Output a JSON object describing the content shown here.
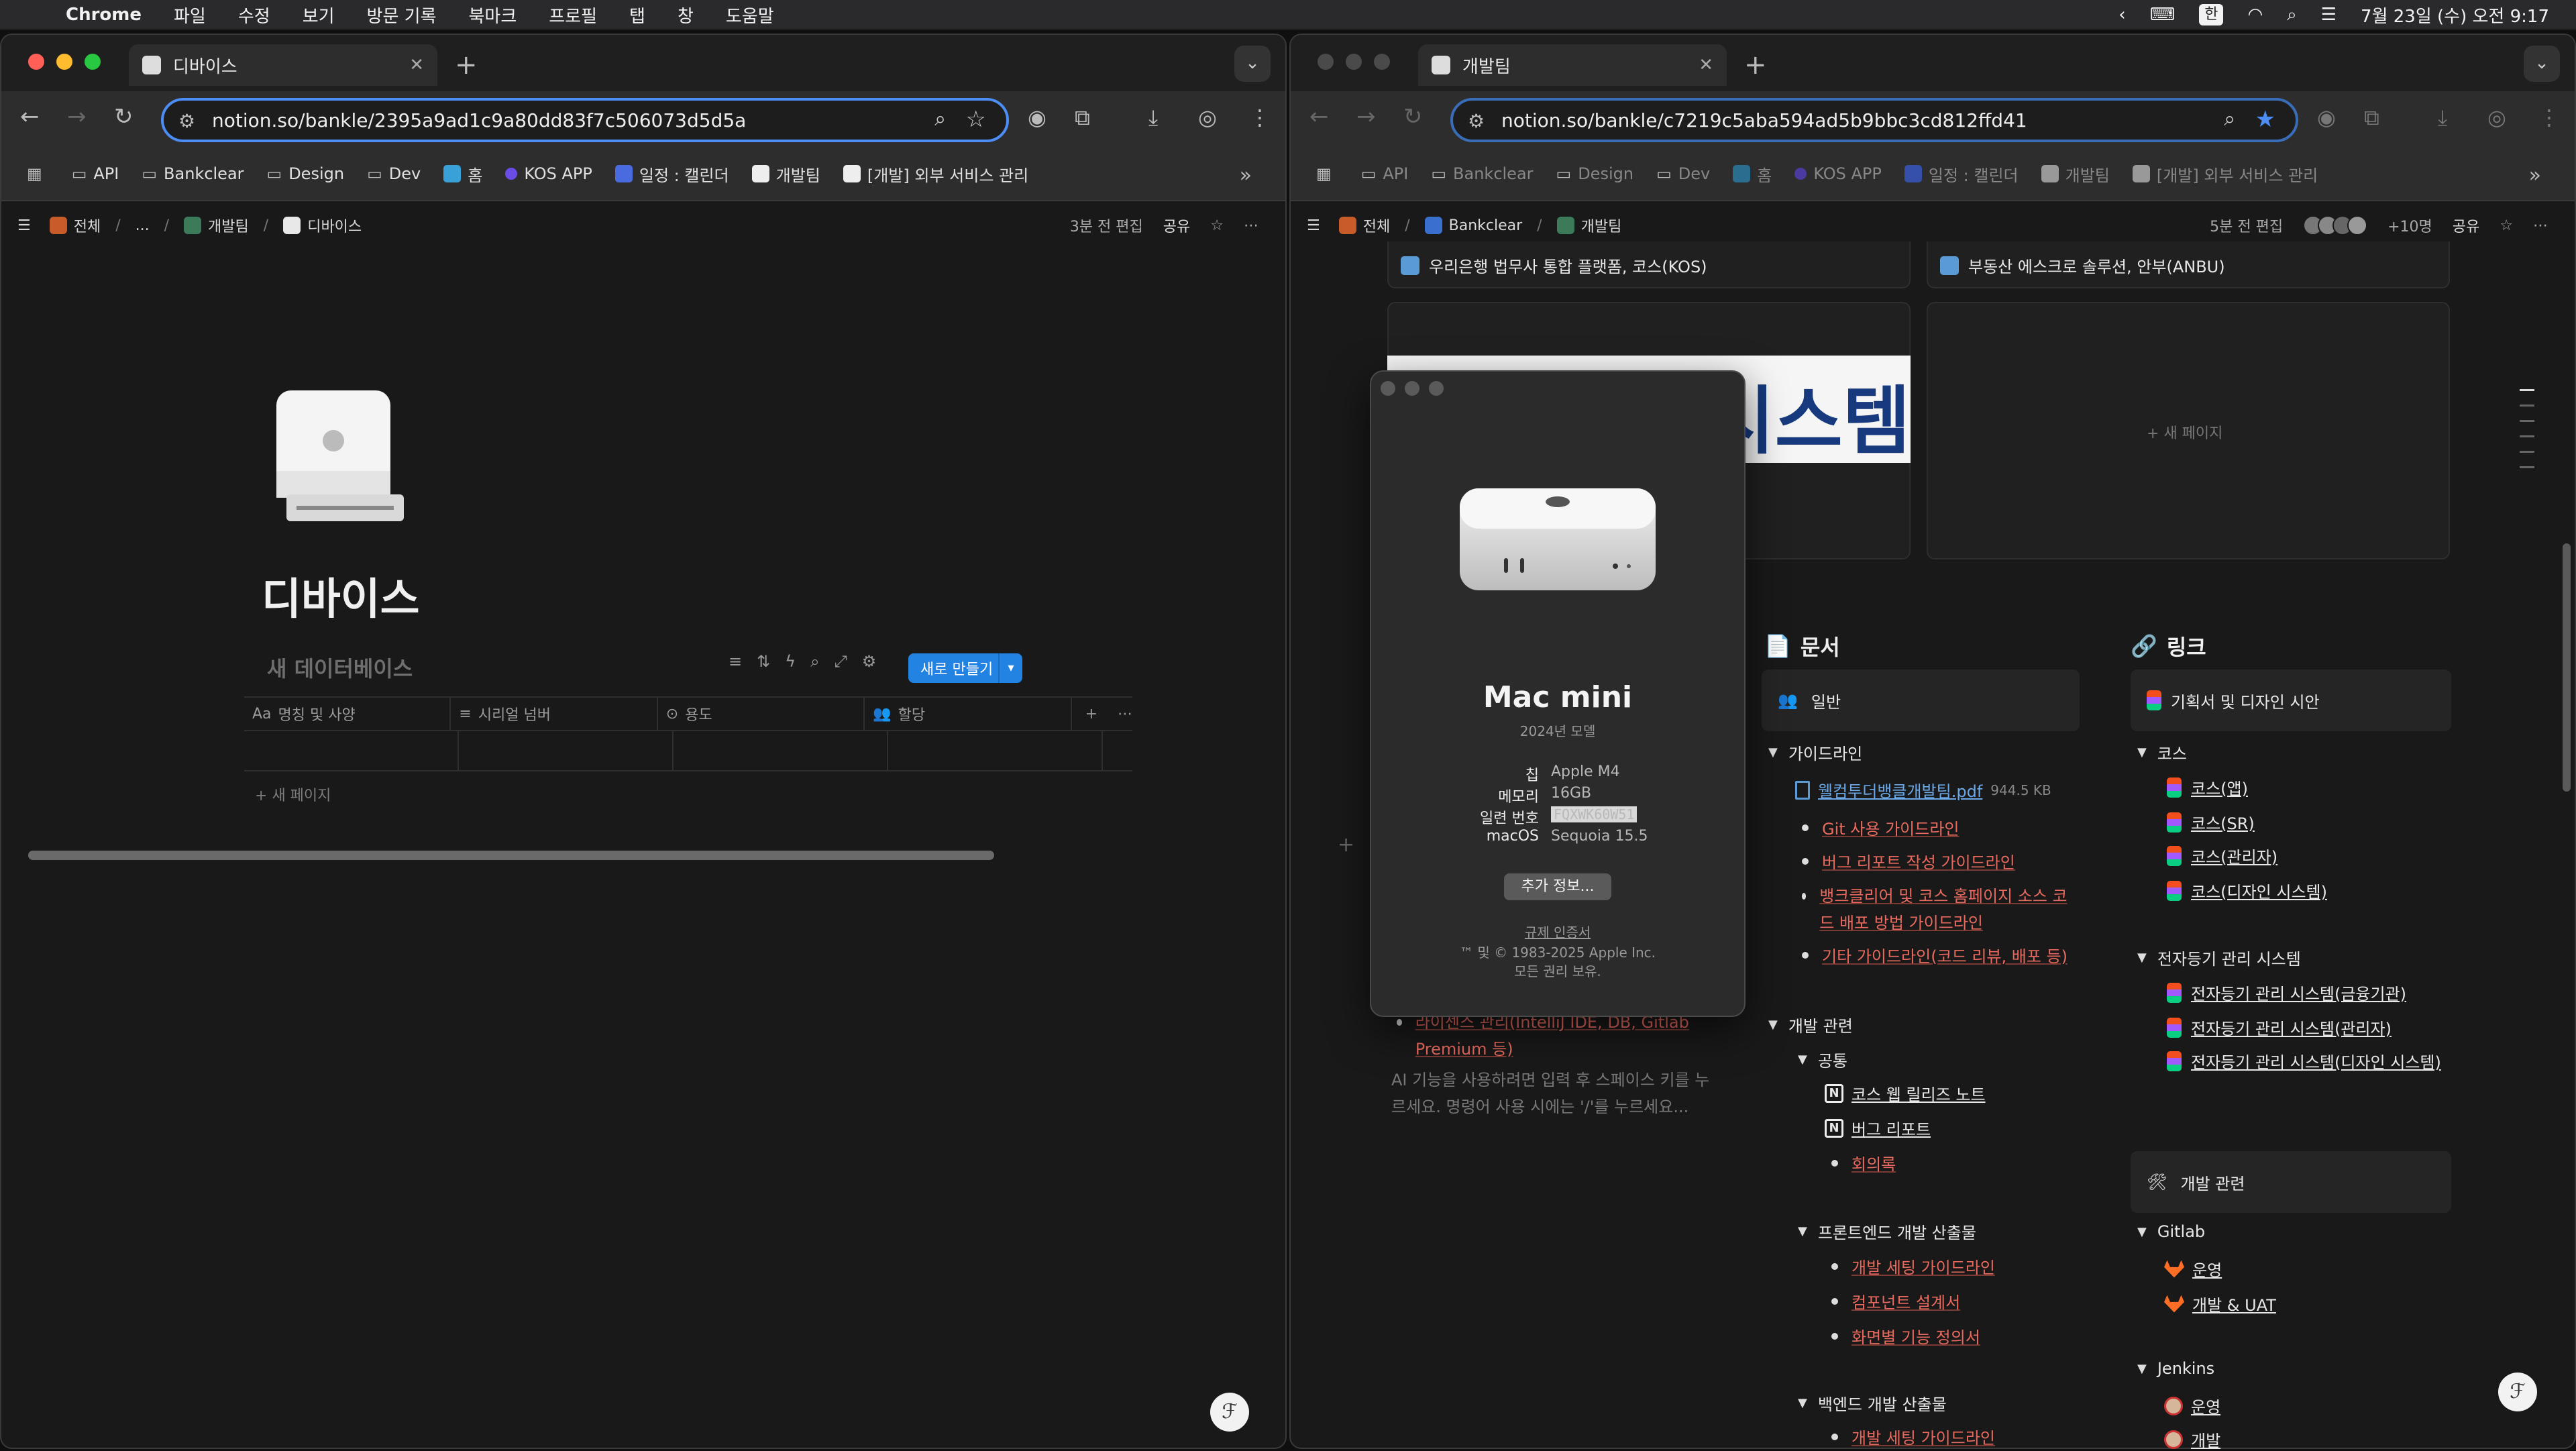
{
  "menubar": {
    "app": "Chrome",
    "items": [
      "파일",
      "수정",
      "보기",
      "방문 기록",
      "북마크",
      "프로필",
      "탭",
      "창",
      "도움말"
    ],
    "input_source": "한",
    "datetime": "7월 23일 (수) 오전 9:17"
  },
  "left": {
    "tab_title": "디바이스",
    "url": "notion.so/bankle/2395a9ad1c9a80dd83f7c506073d5d5a",
    "bookmarks": [
      "API",
      "Bankclear",
      "Design",
      "Dev",
      "홈",
      "KOS APP",
      "일정 : 캘린더",
      "개발팀",
      "[개발] 외부 서비스 관리"
    ],
    "breadcrumb": [
      "전체",
      "...",
      "개발팀",
      "디바이스"
    ],
    "edited": "3분 전 편집",
    "share": "공유",
    "page_title": "디바이스",
    "db_title": "새 데이터베이스",
    "new_button": "새로 만들기",
    "columns": [
      "명칭 및 사양",
      "시리얼 넘버",
      "용도",
      "할당"
    ],
    "new_page": "새 페이지"
  },
  "right": {
    "tab_title": "개발팀",
    "url": "notion.so/bankle/c7219c5aba594ad5b9bbc3cd812ffd41",
    "breadcrumb": [
      "전체",
      "Bankclear",
      "개발팀"
    ],
    "edited": "5분 전 편집",
    "others": "+10명",
    "share": "공유",
    "card1": "우리은행 법무사 통합 플랫폼, 코스(KOS)",
    "card2": "부동산 에스크로 솔루션, 안부(ANBU)",
    "banner_text": "시스템",
    "new_page": "새 페이지",
    "partial_item": "라이센스 관리(IntelliJ IDE, DB, Gitlab Premium 등)",
    "ai_hint": "AI 기능을 사용하려면 입력 후 스페이스 키를 누르세요. 명령어 사용 시에는 '/'를 누르세요...",
    "docs": {
      "heading": "문서",
      "general": "일반",
      "guideline": "가이드라인",
      "pdf": "웰컴투더뱅클개발팀.pdf",
      "pdf_size": "944.5 KB",
      "guide_items": [
        "Git 사용 가이드라인",
        "버그 리포트 작성 가이드라인",
        "뱅크클리어 및 코스 홈페이지 소스 코드 배포 방법 가이드라인",
        "기타 가이드라인(코드 리뷰, 배포 등)"
      ],
      "dev_related": "개발 관련",
      "common": "공통",
      "common_items": [
        "코스 웹 릴리즈 노트",
        "버그 리포트",
        "회의록"
      ],
      "frontend": "프론트엔드 개발 산출물",
      "frontend_items": [
        "개발 세팅 가이드라인",
        "컴포넌트 설계서",
        "화면별 기능 정의서"
      ],
      "backend": "백엔드 개발 산출물",
      "backend_items": [
        "개발 세팅 가이드라인"
      ]
    },
    "links": {
      "heading": "링크",
      "plan": "기획서 및 디자인 시안",
      "kos": "코스",
      "kos_items": [
        "코스(앱)",
        "코스(SR)",
        "코스(관리자)",
        "코스(디자인 시스템)"
      ],
      "registry": "전자등기 관리 시스템",
      "registry_items": [
        "전자등기 관리 시스템(금융기관)",
        "전자등기 관리 시스템(관리자)",
        "전자등기 관리 시스템(디자인 시스템)"
      ],
      "dev_related": "개발 관련",
      "gitlab": "Gitlab",
      "gitlab_items": [
        "운영",
        "개발 & UAT"
      ],
      "jenkins": "Jenkins",
      "jenkins_items": [
        "운영",
        "개발"
      ]
    }
  },
  "about": {
    "model": "Mac mini",
    "year": "2024년 모델",
    "specs": [
      {
        "k": "칩",
        "v": "Apple M4"
      },
      {
        "k": "메모리",
        "v": "16GB"
      },
      {
        "k": "일련 번호",
        "v": "FQXWK60W51"
      },
      {
        "k": "macOS",
        "v": "Sequoia 15.5"
      }
    ],
    "more": "추가 정보...",
    "regulatory": "규제 인증서",
    "copyright": "™ 및 © 1983-2025 Apple Inc.",
    "rights": "모든 권리 보유."
  }
}
